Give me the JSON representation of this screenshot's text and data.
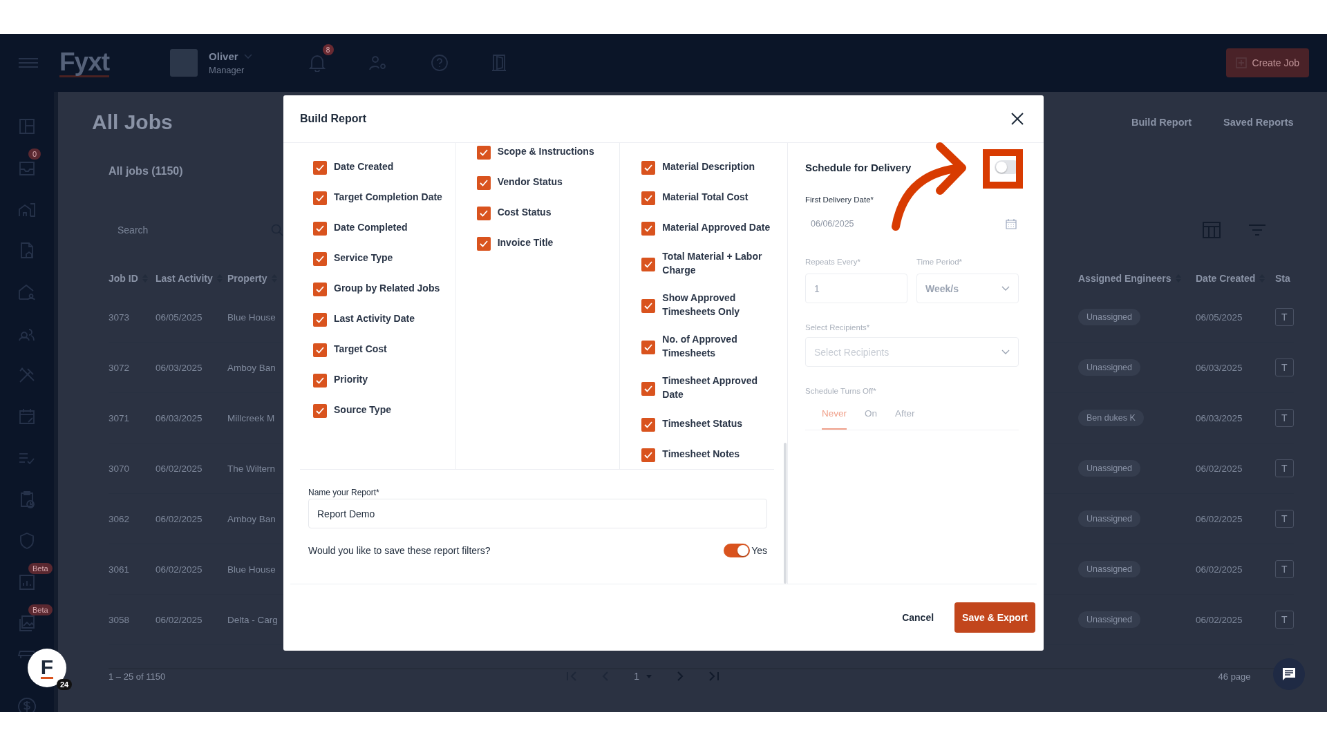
{
  "topbar": {
    "logo": "Fyxt",
    "user": {
      "name": "Oliver",
      "role": "Manager"
    },
    "notification_count": "8",
    "create_button": "Create Job"
  },
  "sidebar": {
    "inbox_badge": "0",
    "reports_badge": "Beta",
    "gallery_badge": "Beta"
  },
  "support_widget": {
    "logo": "F",
    "badge": "24"
  },
  "page": {
    "title": "All Jobs",
    "links": [
      "Build Report",
      "Saved Reports"
    ],
    "subtitle": "All jobs (1150)",
    "search": {
      "placeholder": "Search"
    }
  },
  "table": {
    "columns": [
      "Job ID",
      "Last Activity",
      "Property",
      "Assigned Engineers",
      "Date Created",
      "Sta"
    ],
    "rows": [
      {
        "job_id": "3073",
        "last_activity": "06/05/2025",
        "property": "Blue House",
        "assigned_engineers": "Unassigned",
        "date_created": "06/05/2025",
        "status": "T"
      },
      {
        "job_id": "3072",
        "last_activity": "06/03/2025",
        "property": "Amboy Ban",
        "assigned_engineers": "Unassigned",
        "date_created": "06/03/2025",
        "status": "T"
      },
      {
        "job_id": "3071",
        "last_activity": "06/03/2025",
        "property": "Millcreek M",
        "assigned_engineers": "Ben dukes K",
        "date_created": "06/03/2025",
        "status": "T"
      },
      {
        "job_id": "3070",
        "last_activity": "06/02/2025",
        "property": "The Wiltern",
        "assigned_engineers": "Unassigned",
        "date_created": "06/02/2025",
        "status": "T"
      },
      {
        "job_id": "3062",
        "last_activity": "06/02/2025",
        "property": "Amboy Ban",
        "assigned_engineers": "Unassigned",
        "date_created": "06/02/2025",
        "status": "T"
      },
      {
        "job_id": "3061",
        "last_activity": "06/02/2025",
        "property": "Blue House",
        "assigned_engineers": "Unassigned",
        "date_created": "06/02/2025",
        "status": "T"
      },
      {
        "job_id": "3058",
        "last_activity": "06/02/2025",
        "property": "Delta - Carg",
        "assigned_engineers": "Unassigned",
        "date_created": "06/02/2025",
        "status": "T"
      }
    ]
  },
  "pagination": {
    "range": "1 – 25 of 1150",
    "page": "1",
    "pages": "46 page"
  },
  "modal": {
    "title": "Build Report",
    "columns": [
      [
        {
          "label": "Date Created",
          "checked": true
        },
        {
          "label": "Target Completion Date",
          "checked": true
        },
        {
          "label": "Date Completed",
          "checked": true
        },
        {
          "label": "Service Type",
          "checked": true
        },
        {
          "label": "Group by Related Jobs",
          "checked": true
        },
        {
          "label": "Last Activity Date",
          "checked": true
        },
        {
          "label": "Target Cost",
          "checked": true
        },
        {
          "label": "Priority",
          "checked": true
        },
        {
          "label": "Source Type",
          "checked": true
        }
      ],
      [
        {
          "label": "Scope & Instructions",
          "checked": true
        },
        {
          "label": "Vendor Status",
          "checked": true
        },
        {
          "label": "Cost Status",
          "checked": true
        },
        {
          "label": "Invoice Title",
          "checked": true
        }
      ],
      [
        {
          "label": "Material Description",
          "checked": true
        },
        {
          "label": "Material Total Cost",
          "checked": true
        },
        {
          "label": "Material Approved Date",
          "checked": true
        },
        {
          "label": "Total Material + Labor Charge",
          "checked": true
        },
        {
          "label": "Show Approved Timesheets Only",
          "checked": true
        },
        {
          "label": "No. of Approved Timesheets",
          "checked": true
        },
        {
          "label": "Timesheet Approved Date",
          "checked": true
        },
        {
          "label": "Timesheet Status",
          "checked": true
        },
        {
          "label": "Timesheet Notes",
          "checked": true
        }
      ]
    ],
    "name_field": {
      "label": "Name your Report*",
      "value": "Report Demo"
    },
    "save_filters": {
      "question": "Would you like to save these report filters?",
      "on": true,
      "label": "Yes"
    },
    "schedule": {
      "title": "Schedule for Delivery",
      "on": false,
      "first_date": {
        "label": "First Delivery Date*",
        "value": "06/06/2025"
      },
      "repeats": {
        "label": "Repeats Every*",
        "value": "1"
      },
      "period": {
        "label": "Time Period*",
        "value": "Week/s"
      },
      "recipients": {
        "label": "Select Recipients*",
        "placeholder": "Select Recipients"
      },
      "turns_off": {
        "label": "Schedule Turns Off*",
        "tabs": [
          {
            "label": "Never",
            "selected": true
          },
          {
            "label": "On",
            "selected": false
          },
          {
            "label": "After",
            "selected": false
          }
        ]
      }
    },
    "buttons": {
      "cancel": "Cancel",
      "primary": "Save & Export"
    }
  }
}
